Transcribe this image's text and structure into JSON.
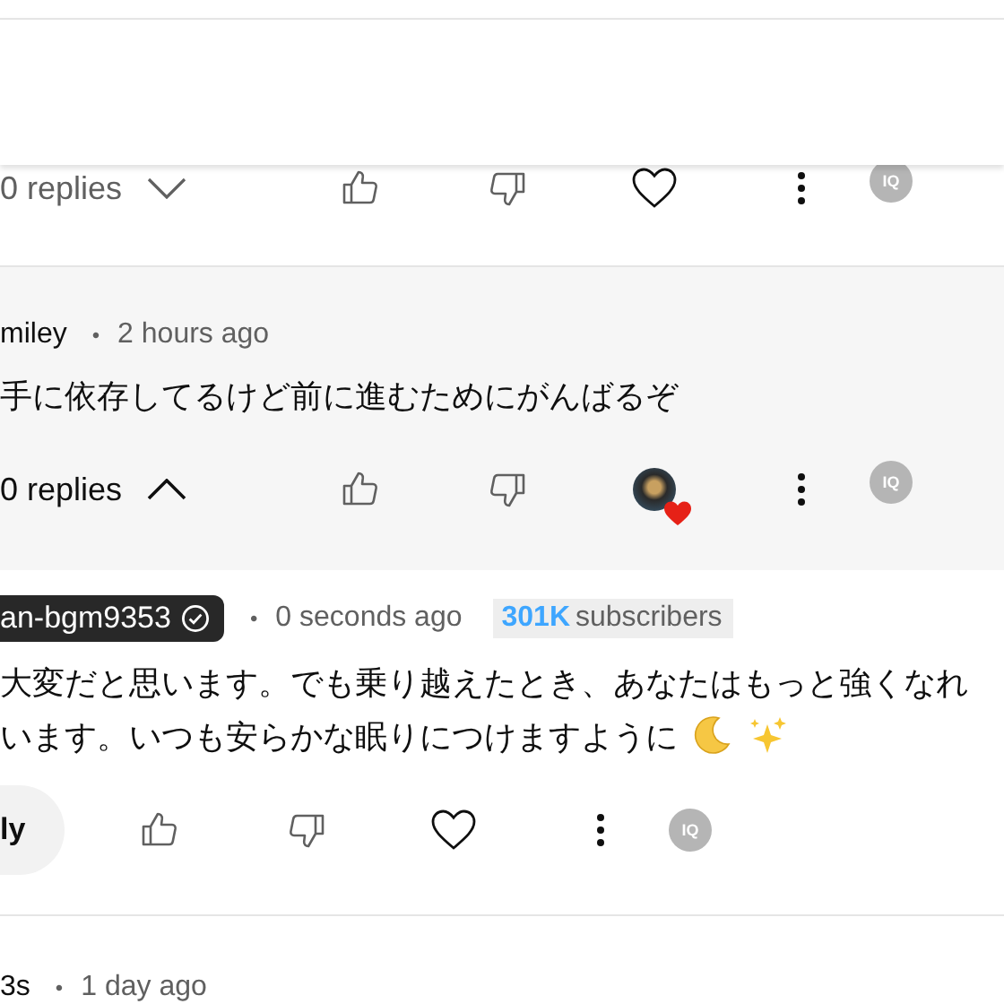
{
  "comments": [
    {
      "kind": "plain",
      "replies": "0 replies",
      "expanded": false,
      "creator_heart": false,
      "badge": "IQ"
    },
    {
      "kind": "highlighted",
      "author": "miley",
      "separator": "•",
      "time": "2 hours ago",
      "text": [
        "手に依存してるけど前に進むためにがんばるぞ"
      ],
      "replies": "0 replies",
      "expanded": true,
      "creator_heart": true,
      "badge": "IQ"
    },
    {
      "kind": "plain",
      "author": "an-bgm9353",
      "owner": true,
      "verified": true,
      "separator": "•",
      "time": "0 seconds ago",
      "subscriber_count": "301K",
      "subscriber_label": "subscribers",
      "text": [
        "大変だと思います。でも乗り越えたとき、あなたはもっと強くなれ",
        "います。いつも安らかな眠りにつけますように"
      ],
      "emoji": [
        {
          "kind": "moon"
        },
        {
          "kind": "sparkles"
        }
      ],
      "reply": "ly",
      "creator_heart": false,
      "badge": "IQ"
    },
    {
      "kind": "plain",
      "author": "3s",
      "separator": "•",
      "time": "1 day ago"
    }
  ]
}
